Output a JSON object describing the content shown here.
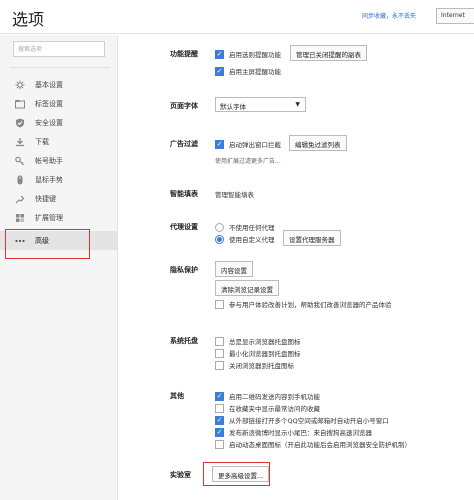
{
  "header": {
    "title": "选项",
    "sync_link": "同步收藏，永不丢失",
    "account_button": "Internet"
  },
  "sidebar": {
    "search_placeholder": "搜索选项",
    "items": [
      {
        "label": "基本设置",
        "icon": "gear-icon"
      },
      {
        "label": "标签设置",
        "icon": "tabs-icon"
      },
      {
        "label": "安全设置",
        "icon": "shield-icon"
      },
      {
        "label": "下载",
        "icon": "download-icon"
      },
      {
        "label": "帐号助手",
        "icon": "key-icon"
      },
      {
        "label": "鼠标手势",
        "icon": "mouse-icon"
      },
      {
        "label": "快捷键",
        "icon": "keyboard-icon"
      },
      {
        "label": "扩展管理",
        "icon": "puzzle-icon"
      },
      {
        "label": "高级",
        "icon": "more-icon",
        "active": true
      }
    ]
  },
  "sections": {
    "features": {
      "label": "功能提醒",
      "options": [
        {
          "label": "启用选则提醒功能",
          "checked": true
        },
        {
          "label": "启用主屏提醒功能",
          "checked": true
        }
      ],
      "button": "管理已关闭提醒的副表"
    },
    "font": {
      "label": "页面字体",
      "select_value": "默认字体"
    },
    "adfilter": {
      "label": "广告过滤",
      "option": {
        "label": "启动弹出窗口拦截",
        "checked": true
      },
      "button": "编辑免过滤列表",
      "note": "使用扩展过滤更多广告..."
    },
    "autofill": {
      "label": "智能填表",
      "link": "管理智能填表"
    },
    "proxy": {
      "label": "代理设置",
      "options": [
        {
          "label": "不使用任何代理",
          "checked": false
        },
        {
          "label": "使用自定义代理",
          "checked": true
        }
      ],
      "button": "设置代理服务器"
    },
    "privacy": {
      "label": "隐私保护",
      "content_button": "内容设置",
      "clear_button": "清除浏览记录设置",
      "option": {
        "label": "参与用户体验改善计划，帮助我们改善浏览器的产品体验",
        "checked": false
      }
    },
    "tray": {
      "label": "系统托盘",
      "options": [
        {
          "label": "总是显示浏览器托盘图标",
          "checked": false
        },
        {
          "label": "最小化浏览器到托盘图标",
          "checked": false
        },
        {
          "label": "关闭浏览器到托盘图标",
          "checked": false
        }
      ]
    },
    "other": {
      "label": "其他",
      "options": [
        {
          "label": "启用二维码发送内容到手机功能",
          "checked": true
        },
        {
          "label": "在收藏夹中显示最常访问的收藏",
          "checked": false
        },
        {
          "label": "从外部链接打开多个QQ空间或邮箱时自动开启小号窗口",
          "checked": true
        },
        {
          "label": "发布新浪微博时显示小尾巴：来自搜狗高速浏览器",
          "checked": true
        },
        {
          "label": "启动动态桌面图标（开启此功能后会启用浏览器安全防护机制）",
          "checked": false
        }
      ]
    },
    "lab": {
      "label": "实验室",
      "button": "更多高级设置..."
    }
  },
  "colors": {
    "accent": "#3b7dd8",
    "highlight": "#e03030",
    "link": "#2a6fc9"
  }
}
